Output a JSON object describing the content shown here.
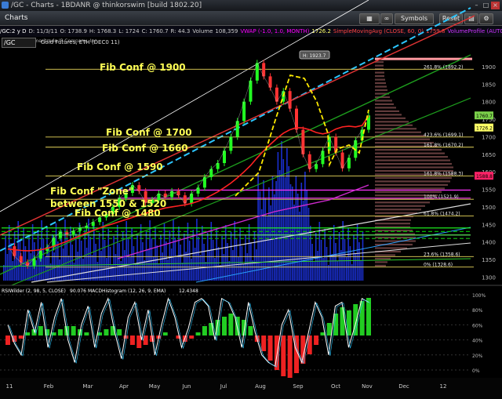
{
  "window": {
    "title": "/GC - Charts - 1BDANR @ thinkorswim [build 1802.20]",
    "tab": "Charts",
    "buttons": {
      "symbols": "Symbols",
      "reset": "Reset",
      "style": "Style",
      "drawings": "Drawings",
      "studies": "Studies"
    },
    "quote": "1760.70"
  },
  "colors": {
    "background": "#000000",
    "price_line": "#dddddd",
    "fib_labels": "#ffff66",
    "sma": "#ff2222",
    "rsi": "#ffffff"
  },
  "symbol_bar": {
    "tokens": [
      "/GC:2 y D",
      "D: 11/3/11",
      "O: 1738.9",
      "H: 1768.3",
      "L: 1724",
      "C: 1760.7",
      "R: 44.3",
      "Volume",
      "108,359",
      "VWAP (-1.0, 1.0, MONTH)",
      "1726.2",
      "SimpleMovingAvg (CLOSE, 60, 0)",
      "1759.8",
      "VolumeProfile (AUTOMATIC, ..."
    ],
    "copyright": "2011 © TD Ameritrade IP Company, Inc.",
    "symbol_input": "/GC",
    "series_title": "Gold Futures, ETH (DEC0 11)"
  },
  "fib_notes": [
    {
      "text": "Fib Conf @ 1900"
    },
    {
      "text": "Fib Conf @ 1700"
    },
    {
      "text": "Fib Conf @ 1660"
    },
    {
      "text": "Fib Conf @ 1590"
    },
    {
      "text": "Fib Conf \"Zone\""
    },
    {
      "text": "between 1550 & 1520"
    },
    {
      "text": "Fib Conf @ 1480"
    }
  ],
  "fib_levels": [
    {
      "label": "261.8% (1892.2)",
      "price": 1892.2
    },
    {
      "label": "423.6% (1699.1)",
      "price": 1699.1
    },
    {
      "label": "161.8% (1670.2)",
      "price": 1670.2
    },
    {
      "label": "161.8% (1588.3)",
      "price": 1588.3
    },
    {
      "label": "100% (1521.9)",
      "price": 1521.9
    },
    {
      "label": "61.8% (1474.2)",
      "price": 1474.2
    },
    {
      "label": "23.6% (1358.6)",
      "price": 1358.6
    },
    {
      "label": "0% (1328.6)",
      "price": 1328.6
    }
  ],
  "high_bubble": "H: 1923.7",
  "price_tags": [
    {
      "text": "1760.7",
      "price": 1760.7,
      "color": "#7bd14a"
    },
    {
      "text": "1726.2",
      "price": 1726.2,
      "color": "#ffff66"
    },
    {
      "text": "1588.8",
      "price": 1588.8,
      "color": "#ff2266"
    }
  ],
  "chart_data": {
    "type": "line",
    "price_axis": {
      "ticks": [
        "1900",
        "1850",
        "1800",
        "1750",
        "1700",
        "1650",
        "1600",
        "1550",
        "1500",
        "1450",
        "1400",
        "1350",
        "1300"
      ],
      "range": [
        1290,
        1960
      ]
    },
    "months": [
      "11",
      "Feb",
      "Mar",
      "Apr",
      "May",
      "Jun",
      "Jul",
      "Aug",
      "Sep",
      "Oct",
      "Nov",
      "Dec",
      "12"
    ],
    "close": [
      1388,
      1360,
      1342,
      1333,
      1353,
      1375,
      1385,
      1412,
      1428,
      1422,
      1432,
      1440,
      1446,
      1457,
      1470,
      1480,
      1500,
      1525,
      1540,
      1562,
      1545,
      1512,
      1520,
      1538,
      1528,
      1545,
      1533,
      1510,
      1538,
      1555,
      1585,
      1608,
      1625,
      1660,
      1700,
      1745,
      1800,
      1860,
      1910,
      1872,
      1840,
      1800,
      1830,
      1780,
      1720,
      1650,
      1608,
      1622,
      1660,
      1700,
      1655,
      1610,
      1640,
      1690,
      1720,
      1760.7
    ],
    "sma": [
      1380,
      1378,
      1376,
      1375,
      1376,
      1378,
      1382,
      1388,
      1395,
      1402,
      1410,
      1418,
      1426,
      1433,
      1440,
      1446,
      1452,
      1458,
      1464,
      1470,
      1476,
      1482,
      1487,
      1492,
      1497,
      1500,
      1503,
      1506,
      1510,
      1516,
      1524,
      1533,
      1543,
      1555,
      1568,
      1583,
      1600,
      1618,
      1640,
      1660,
      1678,
      1695,
      1710,
      1720,
      1726,
      1725,
      1720,
      1712,
      1708,
      1712,
      1722,
      1728,
      1730,
      1728,
      1732,
      1759.8
    ],
    "rsi": {
      "label": "RSIWilder (2, 98, 5, CLOSE)",
      "value": "90.076",
      "ticks": [
        "100%",
        "80%",
        "60%",
        "40%",
        "20%",
        "0%"
      ],
      "values": [
        60,
        35,
        20,
        80,
        50,
        90,
        30,
        70,
        95,
        40,
        10,
        60,
        85,
        30,
        75,
        95,
        50,
        15,
        70,
        90,
        40,
        80,
        20,
        60,
        95,
        70,
        30,
        55,
        90,
        95,
        85,
        40,
        95,
        90,
        70,
        30,
        90,
        50,
        20,
        10,
        5,
        60,
        80,
        30,
        10,
        50,
        90,
        70,
        20,
        85,
        90,
        30,
        60,
        95,
        90
      ]
    },
    "macd_hist": {
      "label": "MACDHistogram (12, 26, 9, EMA)",
      "value": "12.4348",
      "values": [
        -3,
        -2,
        -1,
        1,
        2,
        3,
        2,
        1,
        2,
        3,
        3,
        2,
        1,
        0,
        1,
        2,
        3,
        2,
        -1,
        -3,
        -4,
        -3,
        -2,
        -1,
        1,
        0,
        -1,
        -2,
        -1,
        1,
        3,
        4,
        5,
        6,
        7,
        6,
        5,
        3,
        -2,
        -5,
        -8,
        -11,
        -13,
        -14,
        -12,
        -9,
        -6,
        -3,
        1,
        4,
        7,
        9,
        8,
        10,
        11,
        12
      ]
    },
    "volume_profile_note": "Volume profile on right"
  }
}
